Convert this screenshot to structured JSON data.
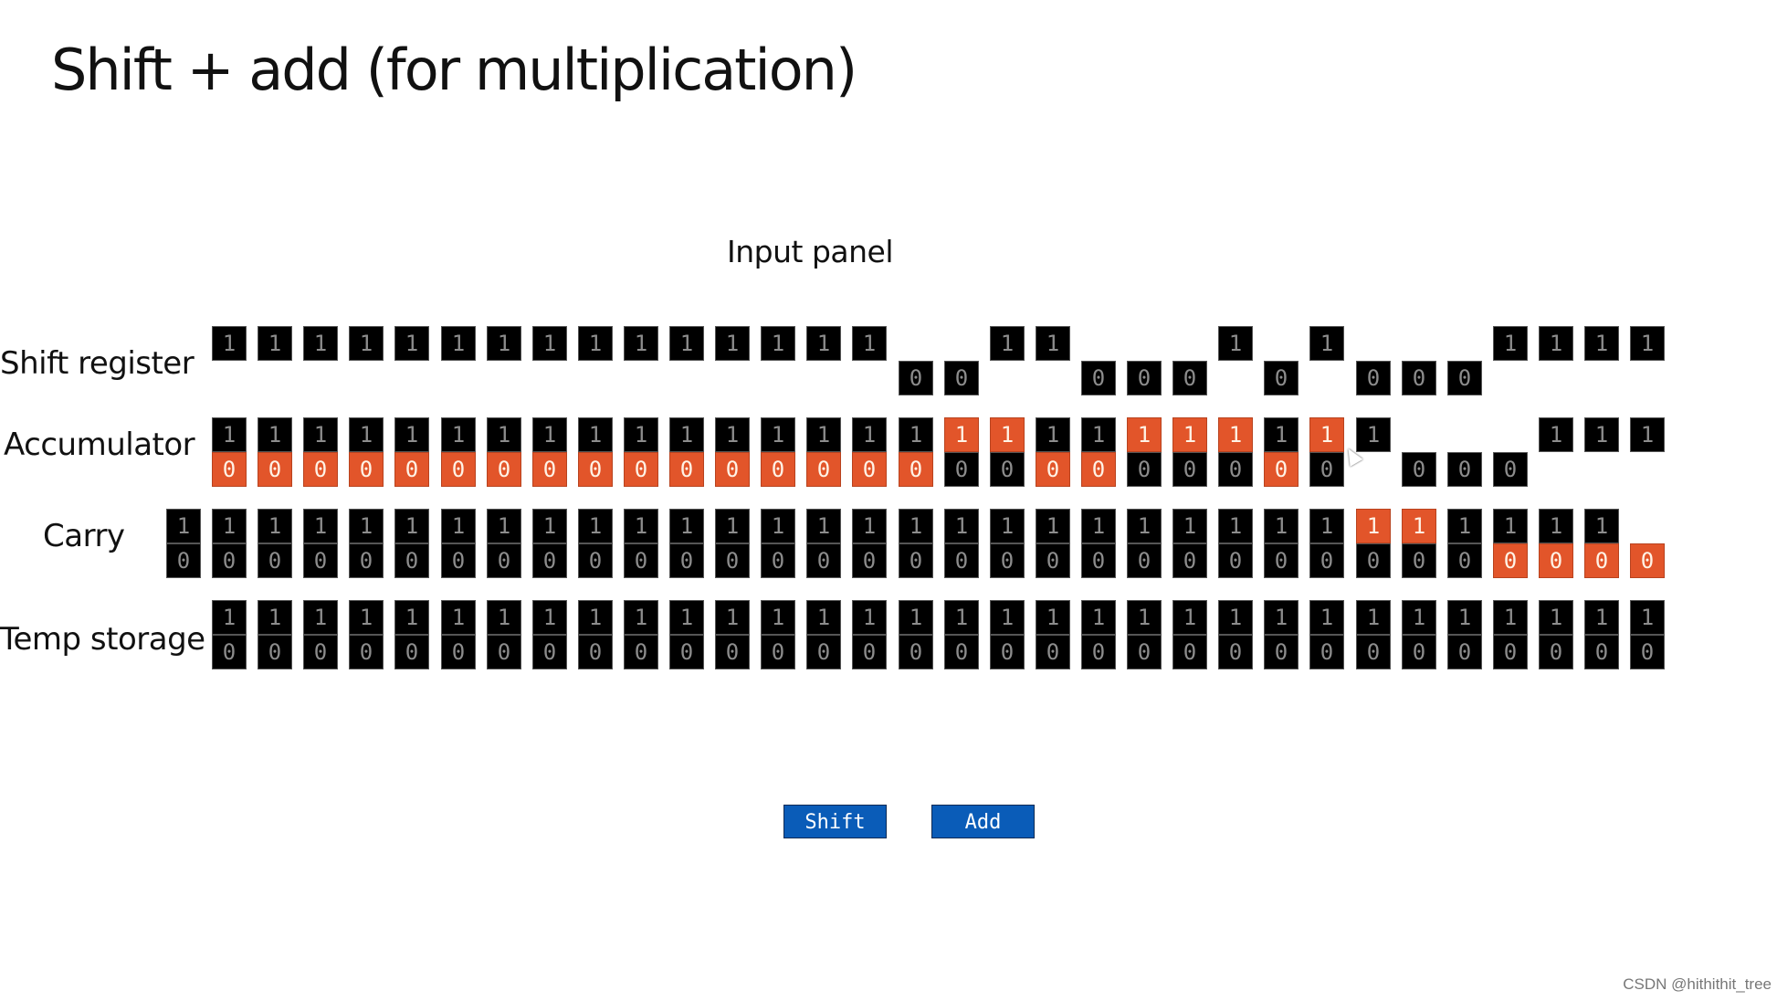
{
  "title": "Shift + add (for multiplication)",
  "panel_title": "Input panel",
  "colors": {
    "orange": "#e2552a",
    "black": "#000000",
    "button_blue": "#0a5cb8"
  },
  "rows": [
    {
      "id": "shift-register",
      "label": "Shift register",
      "first_col": 0,
      "cells": [
        {
          "top": "1",
          "tc": "black"
        },
        {
          "top": "1",
          "tc": "black"
        },
        {
          "top": "1",
          "tc": "black"
        },
        {
          "top": "1",
          "tc": "black"
        },
        {
          "top": "1",
          "tc": "black"
        },
        {
          "top": "1",
          "tc": "black"
        },
        {
          "top": "1",
          "tc": "black"
        },
        {
          "top": "1",
          "tc": "black"
        },
        {
          "top": "1",
          "tc": "black"
        },
        {
          "top": "1",
          "tc": "black"
        },
        {
          "top": "1",
          "tc": "black"
        },
        {
          "top": "1",
          "tc": "black"
        },
        {
          "top": "1",
          "tc": "black"
        },
        {
          "top": "1",
          "tc": "black"
        },
        {
          "top": "1",
          "tc": "black"
        },
        {
          "bottom": "0",
          "bc": "black"
        },
        {
          "bottom": "0",
          "bc": "black"
        },
        {
          "top": "1",
          "tc": "black"
        },
        {
          "top": "1",
          "tc": "black"
        },
        {
          "bottom": "0",
          "bc": "black"
        },
        {
          "bottom": "0",
          "bc": "black"
        },
        {
          "bottom": "0",
          "bc": "black"
        },
        {
          "top": "1",
          "tc": "black"
        },
        {
          "bottom": "0",
          "bc": "black"
        },
        {
          "top": "1",
          "tc": "black"
        },
        {
          "bottom": "0",
          "bc": "black"
        },
        {
          "bottom": "0",
          "bc": "black"
        },
        {
          "bottom": "0",
          "bc": "black"
        },
        {
          "top": "1",
          "tc": "black"
        },
        {
          "top": "1",
          "tc": "black"
        },
        {
          "top": "1",
          "tc": "black"
        },
        {
          "top": "1",
          "tc": "black"
        }
      ]
    },
    {
      "id": "accumulator",
      "label": "Accumulator",
      "first_col": 0,
      "cells": [
        {
          "top": "1",
          "tc": "black",
          "bottom": "0",
          "bc": "orange"
        },
        {
          "top": "1",
          "tc": "black",
          "bottom": "0",
          "bc": "orange"
        },
        {
          "top": "1",
          "tc": "black",
          "bottom": "0",
          "bc": "orange"
        },
        {
          "top": "1",
          "tc": "black",
          "bottom": "0",
          "bc": "orange"
        },
        {
          "top": "1",
          "tc": "black",
          "bottom": "0",
          "bc": "orange"
        },
        {
          "top": "1",
          "tc": "black",
          "bottom": "0",
          "bc": "orange"
        },
        {
          "top": "1",
          "tc": "black",
          "bottom": "0",
          "bc": "orange"
        },
        {
          "top": "1",
          "tc": "black",
          "bottom": "0",
          "bc": "orange"
        },
        {
          "top": "1",
          "tc": "black",
          "bottom": "0",
          "bc": "orange"
        },
        {
          "top": "1",
          "tc": "black",
          "bottom": "0",
          "bc": "orange"
        },
        {
          "top": "1",
          "tc": "black",
          "bottom": "0",
          "bc": "orange"
        },
        {
          "top": "1",
          "tc": "black",
          "bottom": "0",
          "bc": "orange"
        },
        {
          "top": "1",
          "tc": "black",
          "bottom": "0",
          "bc": "orange"
        },
        {
          "top": "1",
          "tc": "black",
          "bottom": "0",
          "bc": "orange"
        },
        {
          "top": "1",
          "tc": "black",
          "bottom": "0",
          "bc": "orange"
        },
        {
          "top": "1",
          "tc": "black",
          "bottom": "0",
          "bc": "orange"
        },
        {
          "top": "1",
          "tc": "orange",
          "bottom": "0",
          "bc": "black"
        },
        {
          "top": "1",
          "tc": "orange",
          "bottom": "0",
          "bc": "black"
        },
        {
          "top": "1",
          "tc": "black",
          "bottom": "0",
          "bc": "orange"
        },
        {
          "top": "1",
          "tc": "black",
          "bottom": "0",
          "bc": "orange"
        },
        {
          "top": "1",
          "tc": "orange",
          "bottom": "0",
          "bc": "black"
        },
        {
          "top": "1",
          "tc": "orange",
          "bottom": "0",
          "bc": "black"
        },
        {
          "top": "1",
          "tc": "orange",
          "bottom": "0",
          "bc": "black"
        },
        {
          "top": "1",
          "tc": "black",
          "bottom": "0",
          "bc": "orange"
        },
        {
          "top": "1",
          "tc": "orange",
          "bottom": "0",
          "bc": "black"
        },
        {
          "top": "1",
          "tc": "black"
        },
        {
          "bottom": "0",
          "bc": "black"
        },
        {
          "bottom": "0",
          "bc": "black"
        },
        {
          "bottom": "0",
          "bc": "black"
        },
        {
          "top": "1",
          "tc": "black"
        },
        {
          "top": "1",
          "tc": "black"
        },
        {
          "top": "1",
          "tc": "black"
        }
      ]
    },
    {
      "id": "carry",
      "label": "Carry",
      "first_col": -1,
      "cells": [
        {
          "top": "1",
          "tc": "black",
          "bottom": "0",
          "bc": "black"
        },
        {
          "top": "1",
          "tc": "black",
          "bottom": "0",
          "bc": "black"
        },
        {
          "top": "1",
          "tc": "black",
          "bottom": "0",
          "bc": "black"
        },
        {
          "top": "1",
          "tc": "black",
          "bottom": "0",
          "bc": "black"
        },
        {
          "top": "1",
          "tc": "black",
          "bottom": "0",
          "bc": "black"
        },
        {
          "top": "1",
          "tc": "black",
          "bottom": "0",
          "bc": "black"
        },
        {
          "top": "1",
          "tc": "black",
          "bottom": "0",
          "bc": "black"
        },
        {
          "top": "1",
          "tc": "black",
          "bottom": "0",
          "bc": "black"
        },
        {
          "top": "1",
          "tc": "black",
          "bottom": "0",
          "bc": "black"
        },
        {
          "top": "1",
          "tc": "black",
          "bottom": "0",
          "bc": "black"
        },
        {
          "top": "1",
          "tc": "black",
          "bottom": "0",
          "bc": "black"
        },
        {
          "top": "1",
          "tc": "black",
          "bottom": "0",
          "bc": "black"
        },
        {
          "top": "1",
          "tc": "black",
          "bottom": "0",
          "bc": "black"
        },
        {
          "top": "1",
          "tc": "black",
          "bottom": "0",
          "bc": "black"
        },
        {
          "top": "1",
          "tc": "black",
          "bottom": "0",
          "bc": "black"
        },
        {
          "top": "1",
          "tc": "black",
          "bottom": "0",
          "bc": "black"
        },
        {
          "top": "1",
          "tc": "black",
          "bottom": "0",
          "bc": "black"
        },
        {
          "top": "1",
          "tc": "black",
          "bottom": "0",
          "bc": "black"
        },
        {
          "top": "1",
          "tc": "black",
          "bottom": "0",
          "bc": "black"
        },
        {
          "top": "1",
          "tc": "black",
          "bottom": "0",
          "bc": "black"
        },
        {
          "top": "1",
          "tc": "black",
          "bottom": "0",
          "bc": "black"
        },
        {
          "top": "1",
          "tc": "black",
          "bottom": "0",
          "bc": "black"
        },
        {
          "top": "1",
          "tc": "black",
          "bottom": "0",
          "bc": "black"
        },
        {
          "top": "1",
          "tc": "black",
          "bottom": "0",
          "bc": "black"
        },
        {
          "top": "1",
          "tc": "black",
          "bottom": "0",
          "bc": "black"
        },
        {
          "top": "1",
          "tc": "black",
          "bottom": "0",
          "bc": "black"
        },
        {
          "top": "1",
          "tc": "orange",
          "bottom": "0",
          "bc": "black"
        },
        {
          "top": "1",
          "tc": "orange",
          "bottom": "0",
          "bc": "black"
        },
        {
          "top": "1",
          "tc": "black",
          "bottom": "0",
          "bc": "black"
        },
        {
          "top": "1",
          "tc": "black",
          "bottom": "0",
          "bc": "orange"
        },
        {
          "top": "1",
          "tc": "black",
          "bottom": "0",
          "bc": "orange"
        },
        {
          "top": "1",
          "tc": "black",
          "bottom": "0",
          "bc": "orange"
        },
        {
          "bottom": "0",
          "bc": "orange"
        }
      ]
    },
    {
      "id": "temp-storage",
      "label": "Temp storage",
      "first_col": 0,
      "cells": [
        {
          "top": "1",
          "tc": "black",
          "bottom": "0",
          "bc": "black"
        },
        {
          "top": "1",
          "tc": "black",
          "bottom": "0",
          "bc": "black"
        },
        {
          "top": "1",
          "tc": "black",
          "bottom": "0",
          "bc": "black"
        },
        {
          "top": "1",
          "tc": "black",
          "bottom": "0",
          "bc": "black"
        },
        {
          "top": "1",
          "tc": "black",
          "bottom": "0",
          "bc": "black"
        },
        {
          "top": "1",
          "tc": "black",
          "bottom": "0",
          "bc": "black"
        },
        {
          "top": "1",
          "tc": "black",
          "bottom": "0",
          "bc": "black"
        },
        {
          "top": "1",
          "tc": "black",
          "bottom": "0",
          "bc": "black"
        },
        {
          "top": "1",
          "tc": "black",
          "bottom": "0",
          "bc": "black"
        },
        {
          "top": "1",
          "tc": "black",
          "bottom": "0",
          "bc": "black"
        },
        {
          "top": "1",
          "tc": "black",
          "bottom": "0",
          "bc": "black"
        },
        {
          "top": "1",
          "tc": "black",
          "bottom": "0",
          "bc": "black"
        },
        {
          "top": "1",
          "tc": "black",
          "bottom": "0",
          "bc": "black"
        },
        {
          "top": "1",
          "tc": "black",
          "bottom": "0",
          "bc": "black"
        },
        {
          "top": "1",
          "tc": "black",
          "bottom": "0",
          "bc": "black"
        },
        {
          "top": "1",
          "tc": "black",
          "bottom": "0",
          "bc": "black"
        },
        {
          "top": "1",
          "tc": "black",
          "bottom": "0",
          "bc": "black"
        },
        {
          "top": "1",
          "tc": "black",
          "bottom": "0",
          "bc": "black"
        },
        {
          "top": "1",
          "tc": "black",
          "bottom": "0",
          "bc": "black"
        },
        {
          "top": "1",
          "tc": "black",
          "bottom": "0",
          "bc": "black"
        },
        {
          "top": "1",
          "tc": "black",
          "bottom": "0",
          "bc": "black"
        },
        {
          "top": "1",
          "tc": "black",
          "bottom": "0",
          "bc": "black"
        },
        {
          "top": "1",
          "tc": "black",
          "bottom": "0",
          "bc": "black"
        },
        {
          "top": "1",
          "tc": "black",
          "bottom": "0",
          "bc": "black"
        },
        {
          "top": "1",
          "tc": "black",
          "bottom": "0",
          "bc": "black"
        },
        {
          "top": "1",
          "tc": "black",
          "bottom": "0",
          "bc": "black"
        },
        {
          "top": "1",
          "tc": "black",
          "bottom": "0",
          "bc": "black"
        },
        {
          "top": "1",
          "tc": "black",
          "bottom": "0",
          "bc": "black"
        },
        {
          "top": "1",
          "tc": "black",
          "bottom": "0",
          "bc": "black"
        },
        {
          "top": "1",
          "tc": "black",
          "bottom": "0",
          "bc": "black"
        },
        {
          "top": "1",
          "tc": "black",
          "bottom": "0",
          "bc": "black"
        },
        {
          "top": "1",
          "tc": "black",
          "bottom": "0",
          "bc": "black"
        }
      ]
    }
  ],
  "buttons": {
    "shift_label": "Shift",
    "add_label": "Add"
  },
  "watermark": "CSDN @hithithit_tree"
}
